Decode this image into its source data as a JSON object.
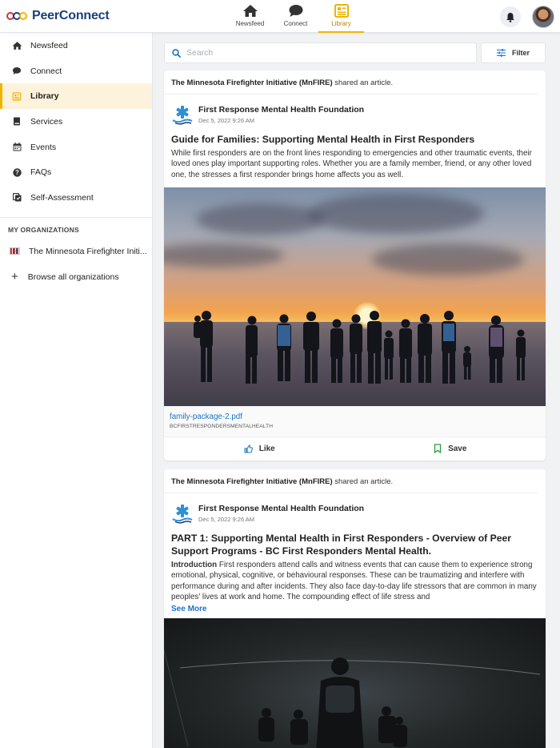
{
  "app": {
    "name": "PeerConnect",
    "colors": {
      "brand": "#1b3f7a",
      "accent": "#f2b400",
      "link": "#1a73c9"
    }
  },
  "topnav": [
    {
      "label": "Newsfeed",
      "icon": "home-icon",
      "active": false
    },
    {
      "label": "Connect",
      "icon": "chat-bubble-icon",
      "active": false
    },
    {
      "label": "Library",
      "icon": "library-icon",
      "active": true
    }
  ],
  "sidebar": {
    "items": [
      {
        "label": "Newsfeed",
        "icon": "home-icon"
      },
      {
        "label": "Connect",
        "icon": "chat-bubble-icon"
      },
      {
        "label": "Library",
        "icon": "library-icon",
        "active": true
      },
      {
        "label": "Services",
        "icon": "book-icon"
      },
      {
        "label": "Events",
        "icon": "calendar-icon"
      },
      {
        "label": "FAQs",
        "icon": "help-icon"
      },
      {
        "label": "Self-Assessment",
        "icon": "assessment-icon"
      }
    ],
    "orgs_heading": "MY ORGANIZATIONS",
    "org": "The Minnesota Firefighter Initi...",
    "browse": "Browse all organizations"
  },
  "search": {
    "placeholder": "Search",
    "value": ""
  },
  "filter_label": "Filter",
  "posts": [
    {
      "sharer": "The Minnesota Firefighter Initiative (MnFIRE)",
      "shared_text": "shared an article.",
      "author": "First Response Mental Health Foundation",
      "date": "Dec 5, 2022 9:26 AM",
      "title": "Guide for Families: Supporting Mental Health in First Responders",
      "excerpt": "While first responders are on the front lines responding to emergencies and other traumatic events, their loved ones play important supporting roles. Whether you are a family member, friend, or any other loved one, the stresses a first responder brings home affects you as well.",
      "attachment_name": "family-package-2.pdf",
      "attachment_source": "BCFIRSTRESPONDERSMENTALHEALTH",
      "like_label": "Like",
      "save_label": "Save"
    },
    {
      "sharer": "The Minnesota Firefighter Initiative (MnFIRE)",
      "shared_text": "shared an article.",
      "author": "First Response Mental Health Foundation",
      "date": "Dec 5, 2022 9:26 AM",
      "title": "PART 1: Supporting Mental Health in First Responders - Overview of Peer Support Programs - BC First Responders Mental Health.",
      "excerpt_lead": "Introduction",
      "excerpt": "First responders attend calls and witness events that can cause them to experience strong emotional, physical, cognitive, or behavioural responses. These can be traumatizing and interfere with performance during and after incidents. They also face day-to-day life stressors that are common in many peoples' lives at work and home. The compounding effect of life stress and",
      "see_more": "See More"
    }
  ]
}
